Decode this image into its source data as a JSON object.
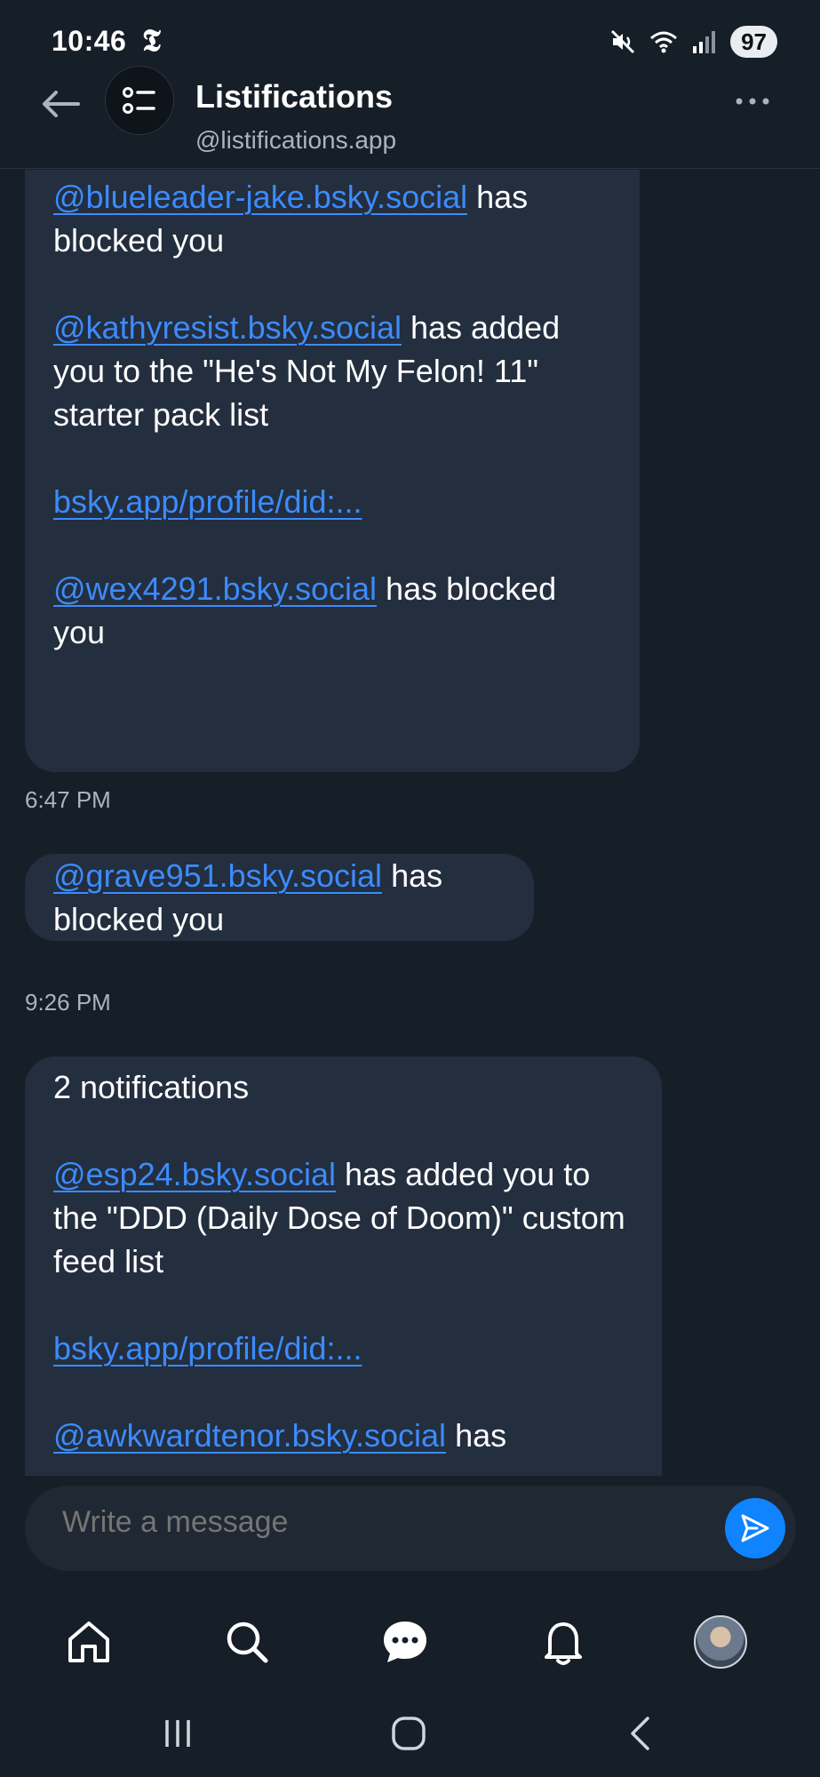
{
  "status": {
    "time": "10:46",
    "battery": "97"
  },
  "header": {
    "name": "Listifications",
    "handle": "@listifications.app"
  },
  "messages": [
    {
      "blocks": [
        {
          "link": "@blueleader-jake.bsky.social",
          "text": " has blocked you"
        },
        {
          "link": "@kathyresist.bsky.social",
          "text": " has added you to the \"He's Not My Felon! 11\" starter pack list"
        },
        {
          "link": "bsky.app/profile/did:...",
          "text": ""
        },
        {
          "link": "@wex4291.bsky.social",
          "text": " has blocked you"
        }
      ],
      "timestamp": "6:47 PM"
    },
    {
      "blocks": [
        {
          "link": "@grave951.bsky.social",
          "text": " has blocked you"
        }
      ],
      "timestamp": "9:26 PM"
    },
    {
      "intro": "2 notifications",
      "blocks": [
        {
          "link": "@esp24.bsky.social",
          "text": " has added you to the \"DDD (Daily Dose of Doom)\" custom feed list"
        },
        {
          "link": "bsky.app/profile/did:...",
          "text": ""
        },
        {
          "link": "@awkwardtenor.bsky.social",
          "text": " has"
        }
      ]
    }
  ],
  "composer": {
    "placeholder": "Write a message"
  },
  "colors": {
    "background": "#161e27",
    "bubble": "#232e3e",
    "link": "#3d8bfd",
    "accent": "#1083fe"
  },
  "icons": [
    "back-arrow-icon",
    "list-icon",
    "more-icon",
    "send-icon",
    "home-icon",
    "search-icon",
    "chat-icon",
    "bell-icon"
  ]
}
